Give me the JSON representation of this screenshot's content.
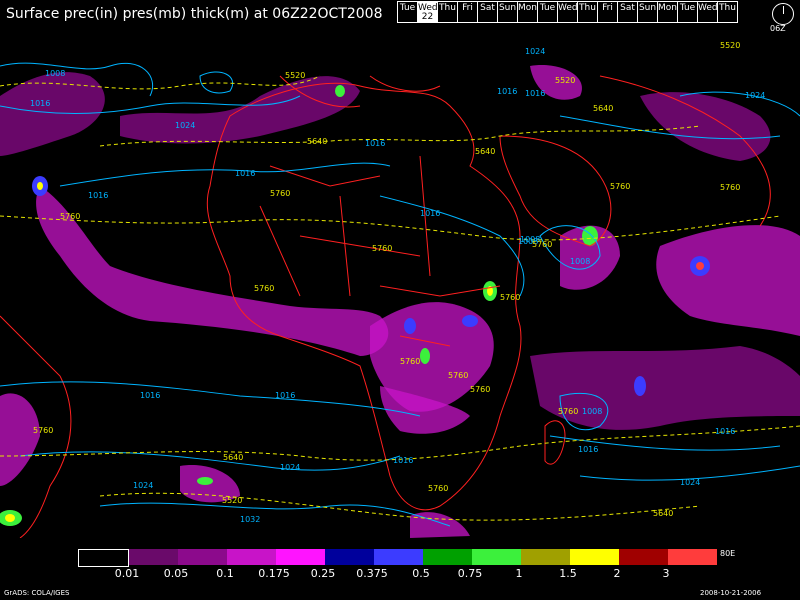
{
  "title": "Surface prec(in) pres(mb) thick(m) at 06Z22OCT2008",
  "days": [
    {
      "label": "Tue",
      "num": ""
    },
    {
      "label": "Wed",
      "num": "22",
      "selected": true
    },
    {
      "label": "Thu",
      "num": ""
    },
    {
      "label": "Fri",
      "num": ""
    },
    {
      "label": "Sat",
      "num": ""
    },
    {
      "label": "Sun",
      "num": ""
    },
    {
      "label": "Mon",
      "num": ""
    },
    {
      "label": "Tue",
      "num": ""
    },
    {
      "label": "Wed",
      "num": ""
    },
    {
      "label": "Thu",
      "num": ""
    },
    {
      "label": "Fri",
      "num": ""
    },
    {
      "label": "Sat",
      "num": ""
    },
    {
      "label": "Sun",
      "num": ""
    },
    {
      "label": "Mon",
      "num": ""
    },
    {
      "label": "Tue",
      "num": ""
    },
    {
      "label": "Wed",
      "num": ""
    },
    {
      "label": "Thu",
      "num": ""
    }
  ],
  "clock_label": "06Z",
  "colorbar": {
    "colors": [
      "#000000",
      "#6a0a6a",
      "#8c0a8c",
      "#c814c8",
      "#ff14ff",
      "#00009c",
      "#3c3cff",
      "#00a000",
      "#3cf03c",
      "#a0a000",
      "#ffff00",
      "#a00000",
      "#ff3c3c"
    ],
    "ticks": [
      "0.01",
      "0.05",
      "0.1",
      "0.175",
      "0.25",
      "0.375",
      "0.5",
      "0.75",
      "1",
      "1.5",
      "2",
      "3"
    ],
    "edge_label": "80E"
  },
  "credit": "GrADS: COLA/IGES",
  "timestamp": "2008-10-21-2006",
  "colors": {
    "isobar": "#00b4ff",
    "thickness": "#e6e600",
    "borders": "#ff2020",
    "precip": "#c814c8"
  },
  "isobar_labels": [
    "1008",
    "1016",
    "1024",
    "1016",
    "1016",
    "1016",
    "1024",
    "1016",
    "1008",
    "1016",
    "1024",
    "1008",
    "1016",
    "1008",
    "1016",
    "1016",
    "1024",
    "1032",
    "1024",
    "1016",
    "1024",
    "1016",
    "1008",
    "1016"
  ],
  "thickness_labels": [
    "5520",
    "5640",
    "5760",
    "5640",
    "5520",
    "5640",
    "5760",
    "5760",
    "5760",
    "5760",
    "5760",
    "5760",
    "5760",
    "5760",
    "5760",
    "5760",
    "5760",
    "5640",
    "5520",
    "5760",
    "5760",
    "5640",
    "5520"
  ]
}
